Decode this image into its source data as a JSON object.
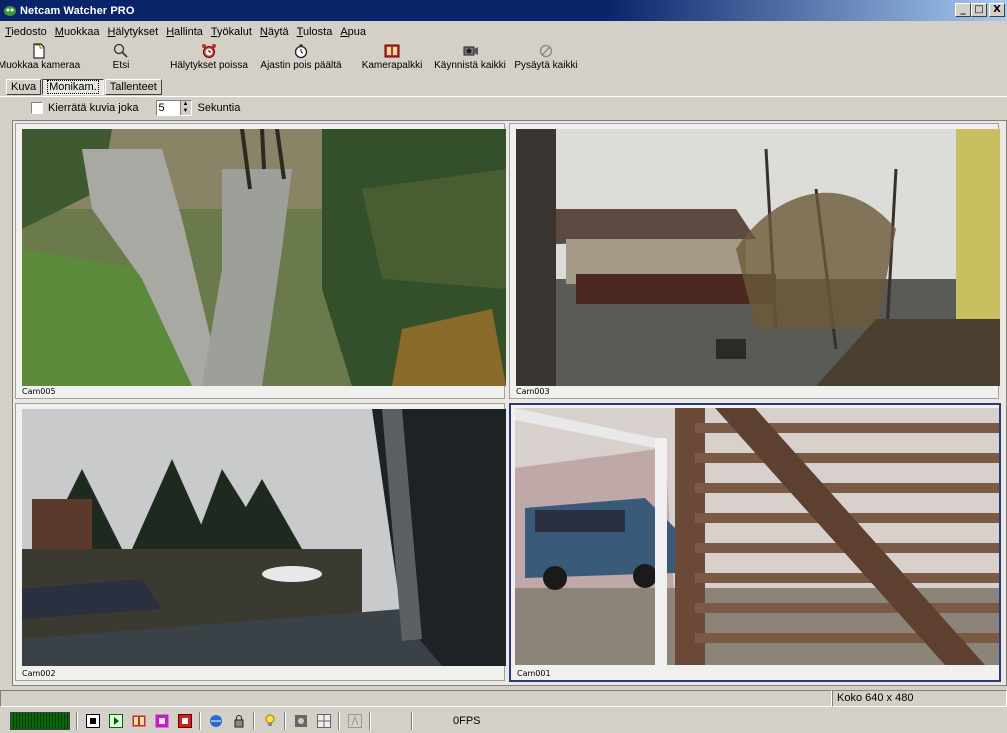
{
  "window": {
    "title": "Netcam Watcher PRO",
    "controls": [
      "_",
      "□",
      "X"
    ]
  },
  "menu": [
    "Tiedosto",
    "Muokkaa",
    "Hälytykset",
    "Hallinta",
    "Työkalut",
    "Näytä",
    "Tulosta",
    "Apua"
  ],
  "toolbar": [
    {
      "label": "Muokkaa kameraa",
      "icon": "new-document-icon"
    },
    {
      "label": "Etsi",
      "icon": "search-icon"
    },
    {
      "label": "Hälytykset poissa",
      "icon": "alarm-clock-icon"
    },
    {
      "label": "Ajastin pois päältä",
      "icon": "timer-icon"
    },
    {
      "label": "Kamerapalkki",
      "icon": "camera-bar-icon"
    },
    {
      "label": "Käynnistä kaikki",
      "icon": "start-all-icon"
    },
    {
      "label": "Pysäytä kaikki",
      "icon": "stop-icon"
    }
  ],
  "tabs": [
    {
      "label": "Kuva",
      "active": false
    },
    {
      "label": "Monikam.",
      "active": true
    },
    {
      "label": "Tallenteet",
      "active": false
    }
  ],
  "options": {
    "rotate_label": "Kierrätä kuvia joka",
    "interval_value": "5",
    "unit_label": "Sekuntia",
    "rotate_checked": false
  },
  "cameras": [
    {
      "name": "Cam005",
      "selected": false,
      "scene": "garden-path"
    },
    {
      "name": "Cam003",
      "selected": false,
      "scene": "street-house"
    },
    {
      "name": "Cam002",
      "selected": false,
      "scene": "window-trees"
    },
    {
      "name": "Cam001",
      "selected": true,
      "scene": "car-fence"
    }
  ],
  "status": {
    "size_text": "Koko 640 x 480",
    "fps": "0FPS"
  },
  "colors": {
    "title_bar": "#0a246a",
    "face": "#d4d0c8",
    "selected_border": "#2a3a7c"
  }
}
